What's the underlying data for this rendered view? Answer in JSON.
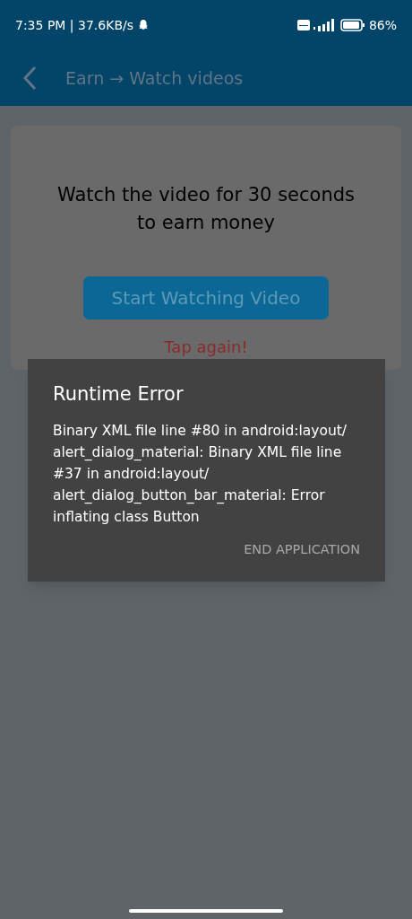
{
  "status_bar": {
    "time": "7:35 PM | 37.6KB/s",
    "battery": "86%"
  },
  "app_bar": {
    "title": "Earn → Watch videos"
  },
  "card": {
    "message": "Watch the video for 30 seconds to earn money",
    "button": "Start Watching Video",
    "hint": "Tap again!"
  },
  "dialog": {
    "title": "Runtime Error",
    "message": "Binary XML file line #80 in android:layout/ alert_dialog_material: Binary XML file line #37 in android:layout/ alert_dialog_button_bar_material: Error inflating class Button",
    "buttons": [
      "END APPLICATION"
    ]
  }
}
